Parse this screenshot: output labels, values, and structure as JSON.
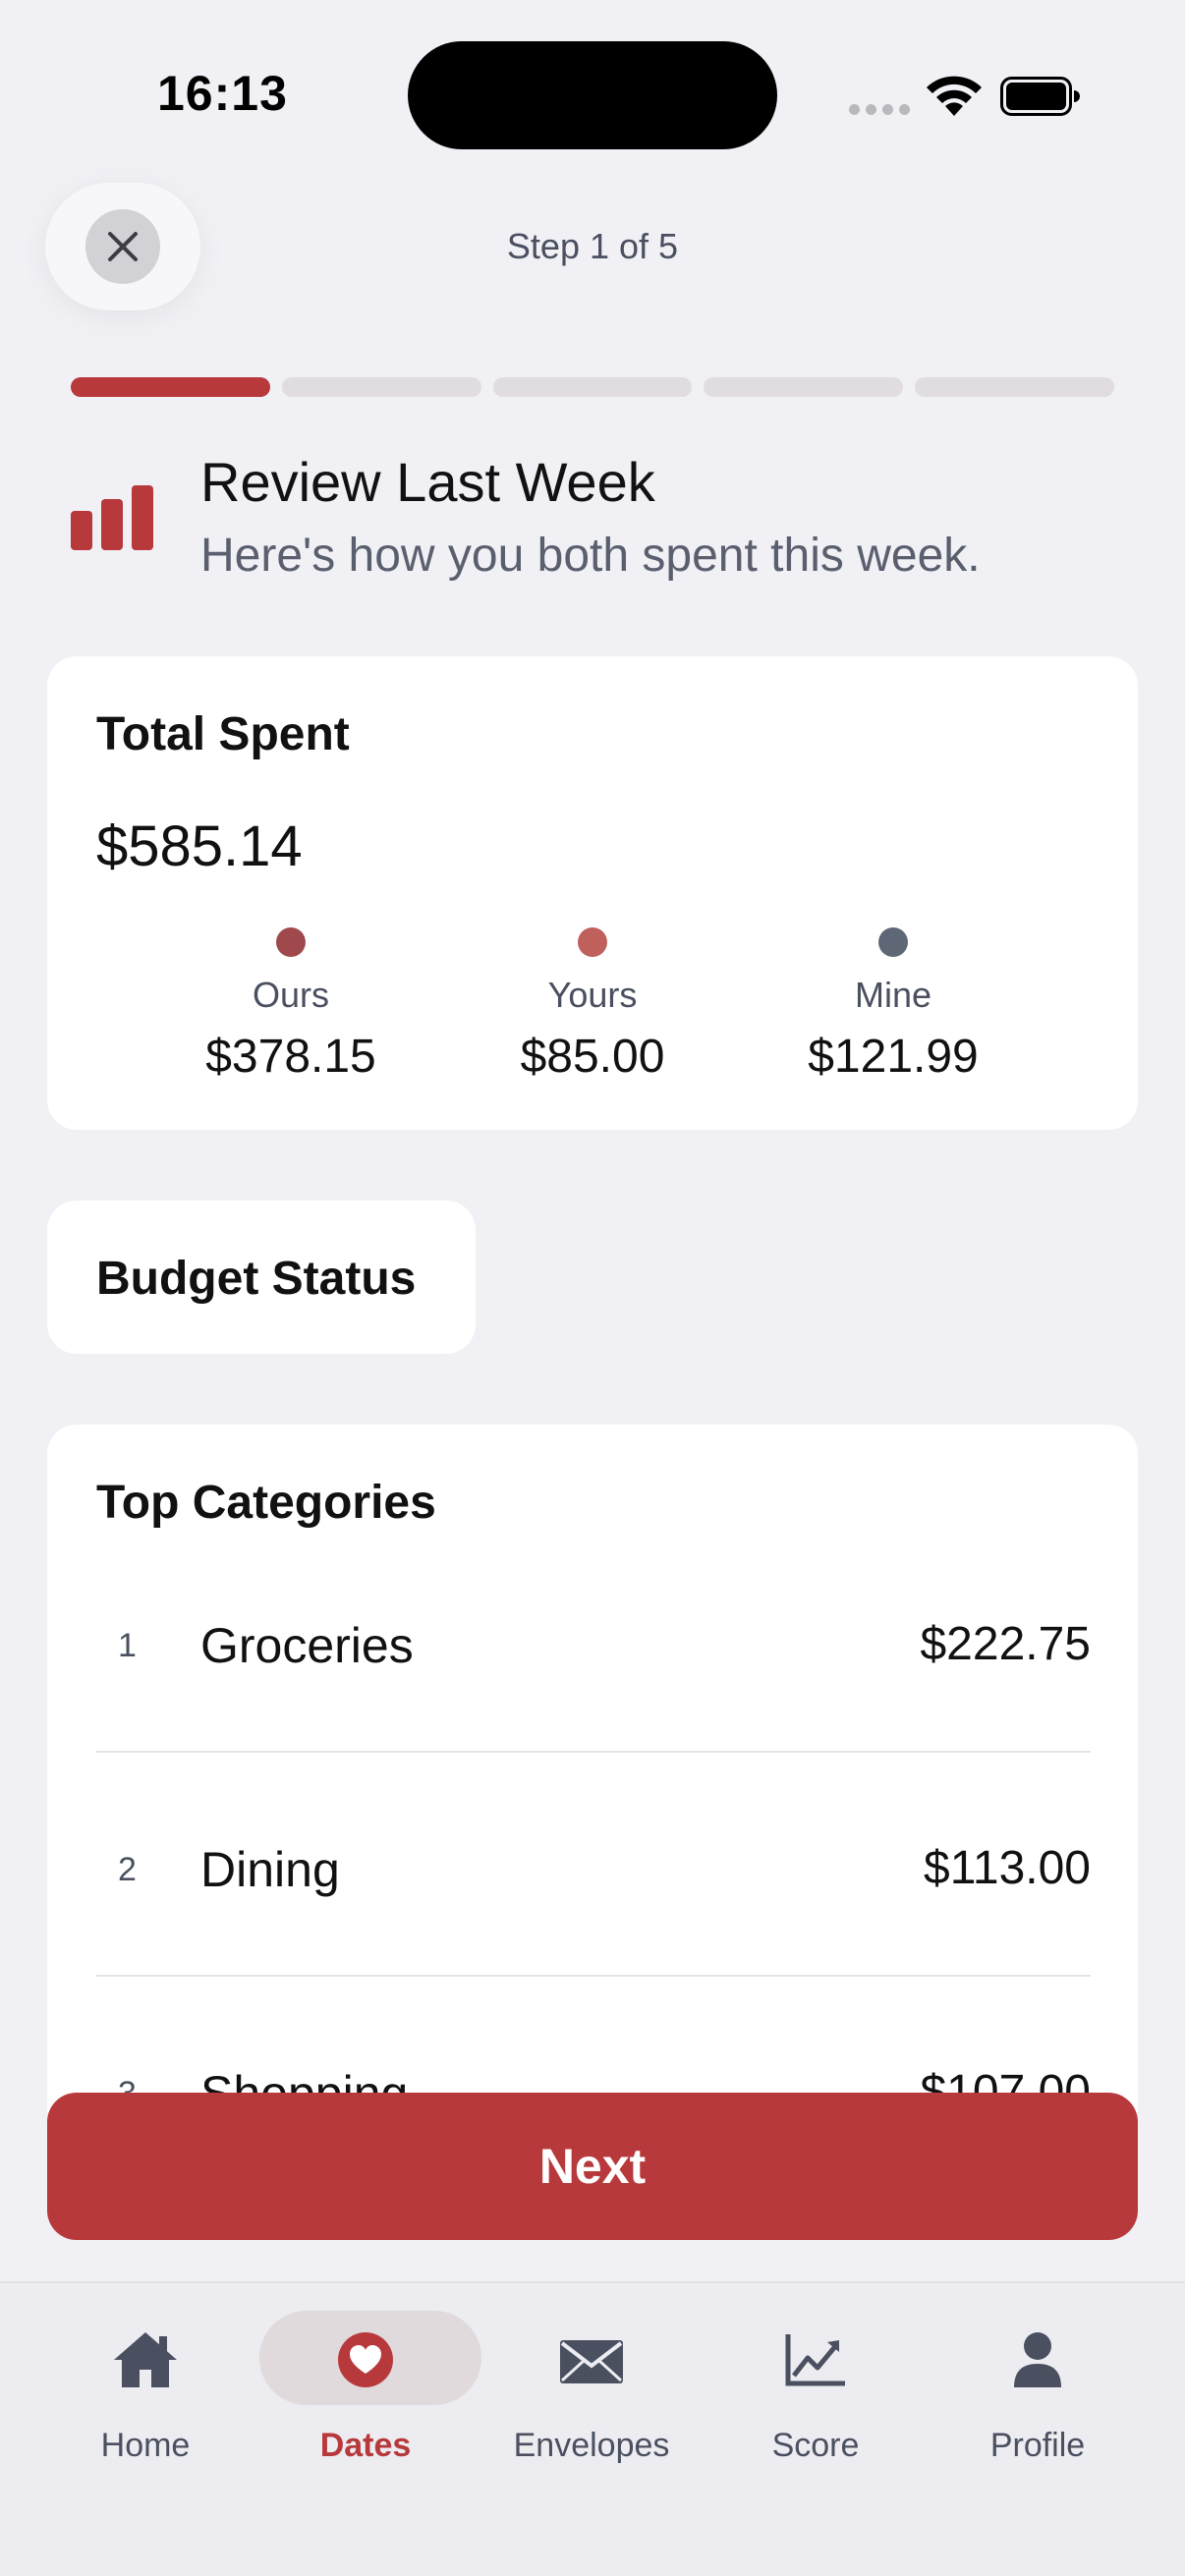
{
  "status_bar": {
    "time": "16:13"
  },
  "header": {
    "step_label": "Step 1 of 5",
    "progress": {
      "current": 1,
      "total": 5
    }
  },
  "step": {
    "title": "Review Last Week",
    "subtitle": "Here's how you both spent this week.",
    "icon": "bar-chart-icon"
  },
  "total_card": {
    "heading": "Total Spent",
    "amount": "$585.14",
    "splits": [
      {
        "label": "Ours",
        "value": "$378.15",
        "color": "#a0494c"
      },
      {
        "label": "Yours",
        "value": "$85.00",
        "color": "#c0605c"
      },
      {
        "label": "Mine",
        "value": "$121.99",
        "color": "#5e6776"
      }
    ]
  },
  "budget_card": {
    "heading": "Budget Status"
  },
  "categories_card": {
    "heading": "Top Categories",
    "items": [
      {
        "rank": "1",
        "name": "Groceries",
        "amount": "$222.75"
      },
      {
        "rank": "2",
        "name": "Dining",
        "amount": "$113.00"
      },
      {
        "rank": "3",
        "name": "Shopping",
        "amount": "$107.00"
      }
    ]
  },
  "next_button": {
    "label": "Next"
  },
  "tabbar": {
    "tabs": [
      {
        "label": "Home",
        "icon": "house-icon"
      },
      {
        "label": "Dates",
        "icon": "heart-icon",
        "active": true
      },
      {
        "label": "Envelopes",
        "icon": "envelope-icon"
      },
      {
        "label": "Score",
        "icon": "chart-line-icon"
      },
      {
        "label": "Profile",
        "icon": "person-icon"
      }
    ]
  },
  "colors": {
    "accent": "#b8393b",
    "background": "#f0f0f5",
    "progress_inactive": "#e1dcdf"
  }
}
